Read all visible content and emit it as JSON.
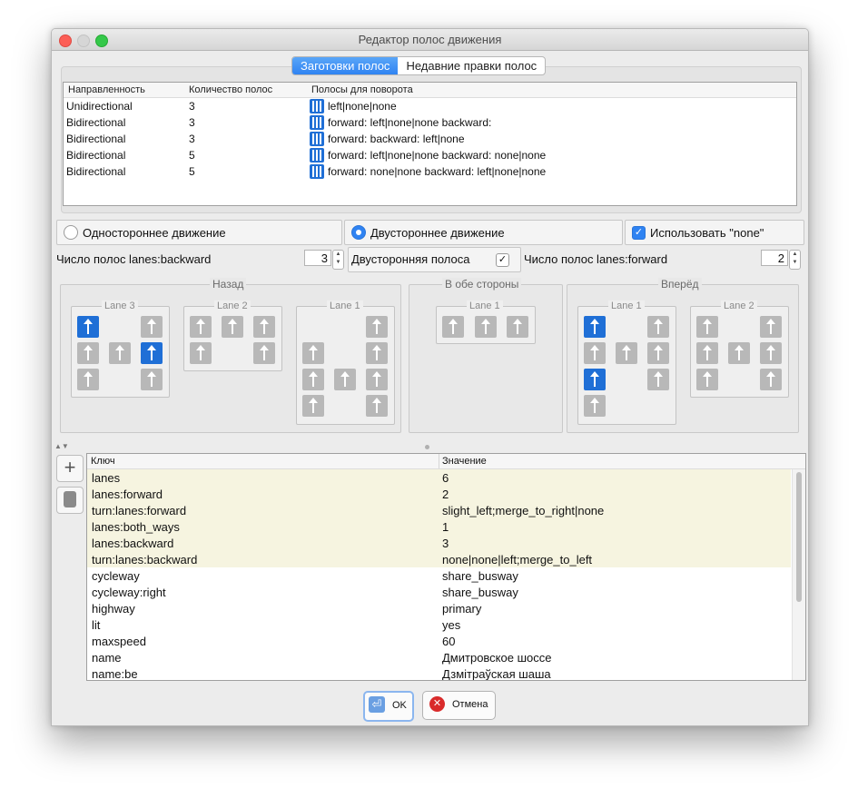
{
  "window": {
    "title": "Редактор полос движения"
  },
  "tabs": [
    {
      "label": "Заготовки полос",
      "selected": true
    },
    {
      "label": "Недавние правки полос",
      "selected": false
    }
  ],
  "presets": {
    "headers": [
      "Направленность",
      "Количество полос",
      "Полосы для поворота"
    ],
    "rows": [
      {
        "dir": "Unidirectional",
        "count": "3",
        "turns": "left|none|none"
      },
      {
        "dir": "Bidirectional",
        "count": "3",
        "turns": "forward: left|none|none backward:"
      },
      {
        "dir": "Bidirectional",
        "count": "3",
        "turns": "forward:  backward: left|none"
      },
      {
        "dir": "Bidirectional",
        "count": "5",
        "turns": "forward: left|none|none backward: none|none"
      },
      {
        "dir": "Bidirectional",
        "count": "5",
        "turns": "forward: none|none backward: left|none|none"
      }
    ]
  },
  "options": {
    "oneway": "Одностороннее движение",
    "twoway": "Двустороннее движение",
    "use_none": "Использовать \"none\"",
    "selected": "twoway"
  },
  "lanes_counts": {
    "backward_label": "Число полос lanes:backward",
    "backward_value": "3",
    "both_ways_label": "Двусторонняя полоса",
    "both_ways_checked": "✓",
    "forward_label": "Число полос lanes:forward",
    "forward_value": "2"
  },
  "groups": {
    "back": "Назад",
    "both": "В обе стороны",
    "fwd": "Вперёд",
    "lane1": "Lane 1",
    "lane2": "Lane 2",
    "lane3": "Lane 3"
  },
  "tags": {
    "headers": [
      "Ключ",
      "Значение"
    ],
    "rows": [
      {
        "key": "lanes",
        "value": "6",
        "highlight": true
      },
      {
        "key": "lanes:forward",
        "value": "2",
        "highlight": true
      },
      {
        "key": "turn:lanes:forward",
        "value": "slight_left;merge_to_right|none",
        "highlight": true
      },
      {
        "key": "lanes:both_ways",
        "value": "1",
        "highlight": true
      },
      {
        "key": "lanes:backward",
        "value": "3",
        "highlight": true
      },
      {
        "key": "turn:lanes:backward",
        "value": "none|none|left;merge_to_left",
        "highlight": true
      },
      {
        "key": "cycleway",
        "value": "share_busway",
        "highlight": false
      },
      {
        "key": "cycleway:right",
        "value": "share_busway",
        "highlight": false
      },
      {
        "key": "highway",
        "value": "primary",
        "highlight": false
      },
      {
        "key": "lit",
        "value": "yes",
        "highlight": false
      },
      {
        "key": "maxspeed",
        "value": "60",
        "highlight": false
      },
      {
        "key": "name",
        "value": "Дмитровское шоссе",
        "highlight": false
      },
      {
        "key": "name:be",
        "value": "Дзмітраўская шаша",
        "highlight": false
      }
    ]
  },
  "buttons": {
    "ok": "OK",
    "cancel": "Отмена"
  },
  "colors": {
    "accent": "#2f83f2",
    "lane_active": "#1f6fd6",
    "lane_inactive": "#b8b8b8",
    "tag_highlight": "#f6f4e0"
  }
}
